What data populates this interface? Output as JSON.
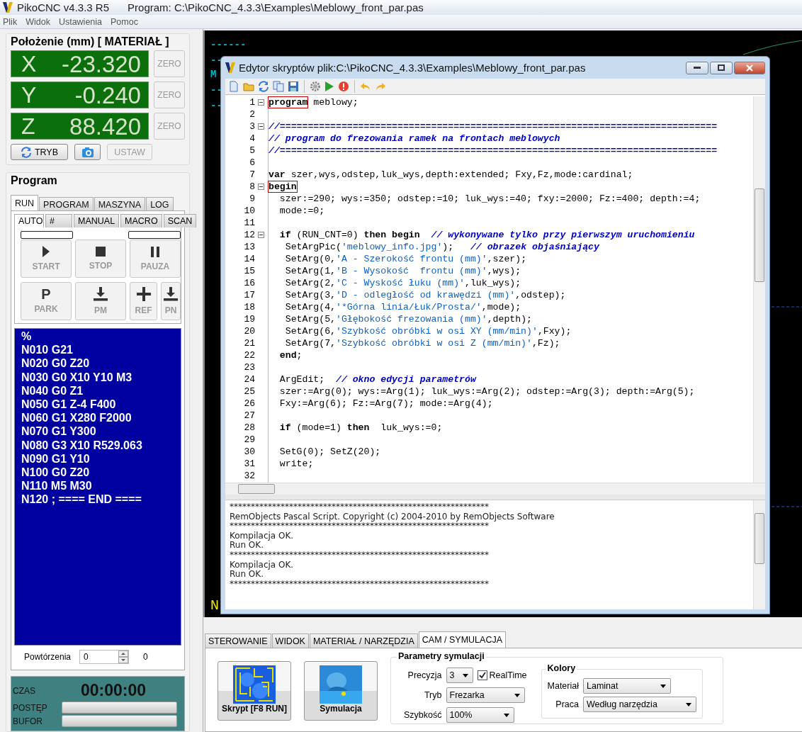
{
  "window": {
    "title": "PikoCNC v4.3.3 R5",
    "program": "Program: C:\\PikoCNC_4.3.3\\Examples\\Meblowy_front_par.pas"
  },
  "menu": [
    "Plik",
    "Widok",
    "Ustawienia",
    "Pomoc"
  ],
  "position": {
    "title": "Położenie (mm) [ MATERIAŁ ]",
    "axes": [
      {
        "axis": "X",
        "value": "-23.320",
        "button": "ZERO",
        "disabled": true
      },
      {
        "axis": "Y",
        "value": "-0.240",
        "button": "ZERO",
        "disabled": true
      },
      {
        "axis": "Z",
        "value": "88.420",
        "button": "ZERO",
        "disabled": true
      }
    ],
    "buttons": [
      {
        "kind": "mode",
        "label": "TRYB",
        "disabled": false
      },
      {
        "kind": "camera",
        "disabled": false
      },
      {
        "kind": "text",
        "label": "USTAW",
        "disabled": true
      }
    ]
  },
  "program": {
    "title": "Program",
    "tabs": [
      {
        "label": "RUN",
        "selected": true
      },
      {
        "label": "PROGRAM",
        "selected": false
      },
      {
        "label": "MASZYNA",
        "selected": false
      },
      {
        "label": "LOG",
        "selected": false
      }
    ],
    "subtabs": [
      {
        "label": "AUTO",
        "selected": true
      },
      {
        "label": "#",
        "selected": false
      },
      {
        "label": "MANUAL",
        "selected": false
      },
      {
        "label": "MACRO",
        "selected": false
      },
      {
        "label": "SCAN",
        "selected": false
      }
    ],
    "indicators": [
      {
        "level": 0
      },
      {
        "level": 0
      }
    ],
    "buttons": [
      {
        "kind": "play",
        "label": "START",
        "disabled": true
      },
      {
        "kind": "stop",
        "label": "STOP",
        "disabled": true
      },
      {
        "kind": "pause",
        "label": "PAUZA",
        "disabled": true
      },
      {
        "kind": "glyph",
        "glyph": "P",
        "label": "PARK",
        "disabled": true
      },
      {
        "kind": "down",
        "label": "PM",
        "disabled": true
      },
      {
        "kind": "plus",
        "label": "REF",
        "disabled": true
      },
      {
        "kind": "down",
        "label": "PN",
        "disabled": true
      }
    ],
    "gcode": [
      "%",
      "N010 G21",
      "N020 G0 Z20",
      "N030 G0 X10 Y10 M3",
      "N040 G0 Z1",
      "N050 G1 Z-4 F400",
      "N060 G1 X280 F2000",
      "N070 G1 Y300",
      "N080 G3 X10 R529.063",
      "N090 G1 Y10",
      "N100 G0 Z20",
      "N110 M5 M30",
      "N120 ; ==== END ===="
    ],
    "repeats": {
      "label": "Powtórzenia",
      "value": "0",
      "count": "0"
    },
    "status": {
      "time_label": "CZAS",
      "time": "00:00:00",
      "bars": [
        {
          "label": "POSTĘP",
          "level": 0
        },
        {
          "label": "BUFOR",
          "level": 0
        }
      ]
    }
  },
  "canvas": {
    "labels": [
      {
        "text": "------",
        "color": "#00b8c8"
      },
      {
        "text": "--",
        "color": "#00b8c8"
      },
      {
        "text": "M",
        "color": "#00b8c8"
      },
      {
        "text": "--",
        "color": "#00b8c8"
      },
      {
        "text": "--",
        "color": "#00b8c8"
      },
      {
        "text": "N",
        "color": "#e8e800"
      }
    ]
  },
  "editor": {
    "title": "Edytor skryptów plik:C:\\PikoCNC_4.3.3\\Examples\\Meblowy_front_par.pas",
    "lines": [
      {
        "number": "1",
        "fold": true,
        "segments": [
          {
            "kind": "keyword",
            "text": "program",
            "highlighted": true
          },
          {
            "kind": "plain",
            "text": " meblowy;"
          }
        ]
      },
      {
        "number": "2",
        "fold": false
      },
      {
        "number": "3",
        "fold": true,
        "segments": [
          {
            "kind": "comment",
            "text": "//=============================================================================="
          }
        ]
      },
      {
        "number": "4",
        "fold": false,
        "segments": [
          {
            "kind": "comment",
            "text": "// program do frezowania ramek na frontach meblowych"
          }
        ]
      },
      {
        "number": "5",
        "fold": false,
        "segments": [
          {
            "kind": "comment",
            "text": "//=============================================================================="
          }
        ]
      },
      {
        "number": "6",
        "fold": false
      },
      {
        "number": "7",
        "fold": false,
        "segments": [
          {
            "kind": "keyword",
            "text": "var"
          },
          {
            "kind": "plain",
            "text": " szer,wys,odstep,luk_wys,depth:extended; Fxy,Fz,mode:cardinal;"
          }
        ]
      },
      {
        "number": "8",
        "fold": true,
        "segments": [
          {
            "kind": "keyword",
            "text": "begin",
            "highlighted": true
          }
        ]
      },
      {
        "number": "9",
        "fold": false,
        "segments": [
          {
            "kind": "plain",
            "text": "  szer:=290; wys:=350; odstep:=10; luk_wys:=40; fxy:=2000; Fz:=400; depth:=4;"
          }
        ]
      },
      {
        "number": "10",
        "fold": false,
        "segments": [
          {
            "kind": "plain",
            "text": "  mode:=0;"
          }
        ]
      },
      {
        "number": "11",
        "fold": false
      },
      {
        "number": "12",
        "fold": true,
        "segments": [
          {
            "kind": "keyword",
            "text": "  if"
          },
          {
            "kind": "plain",
            "text": " (RUN_CNT=0) "
          },
          {
            "kind": "keyword",
            "text": "then begin"
          },
          {
            "kind": "comment",
            "text": "  // wykonywane tylko przy pierwszym uruchomieniu"
          }
        ]
      },
      {
        "number": "13",
        "fold": false,
        "segments": [
          {
            "kind": "plain",
            "text": "   SetArgPic("
          },
          {
            "kind": "string",
            "text": "'meblowy_info.jpg'"
          },
          {
            "kind": "plain",
            "text": ");   "
          },
          {
            "kind": "comment",
            "text": "// obrazek objaśniający"
          }
        ]
      },
      {
        "number": "14",
        "fold": false,
        "segments": [
          {
            "kind": "plain",
            "text": "   SetArg(0,"
          },
          {
            "kind": "string",
            "text": "'A - Szerokość frontu (mm)'"
          },
          {
            "kind": "plain",
            "text": ",szer);"
          }
        ]
      },
      {
        "number": "15",
        "fold": false,
        "segments": [
          {
            "kind": "plain",
            "text": "   SetArg(1,"
          },
          {
            "kind": "string",
            "text": "'B - Wysokość  frontu (mm)'"
          },
          {
            "kind": "plain",
            "text": ",wys);"
          }
        ]
      },
      {
        "number": "16",
        "fold": false,
        "segments": [
          {
            "kind": "plain",
            "text": "   SetArg(2,"
          },
          {
            "kind": "string",
            "text": "'C - Wyskość łuku (mm)'"
          },
          {
            "kind": "plain",
            "text": ",luk_wys);"
          }
        ]
      },
      {
        "number": "17",
        "fold": false,
        "segments": [
          {
            "kind": "plain",
            "text": "   SetArg(3,"
          },
          {
            "kind": "string",
            "text": "'D - odległość od krawędzi (mm)'"
          },
          {
            "kind": "plain",
            "text": ",odstep);"
          }
        ]
      },
      {
        "number": "18",
        "fold": false,
        "segments": [
          {
            "kind": "plain",
            "text": "   SetArg(4,"
          },
          {
            "kind": "string",
            "text": "'*Górna linia/Łuk/Prosta/'"
          },
          {
            "kind": "plain",
            "text": ",mode);"
          }
        ]
      },
      {
        "number": "19",
        "fold": false,
        "segments": [
          {
            "kind": "plain",
            "text": "   SetArg(5,"
          },
          {
            "kind": "string",
            "text": "'Głębokość frezowania (mm)'"
          },
          {
            "kind": "plain",
            "text": ",depth);"
          }
        ]
      },
      {
        "number": "20",
        "fold": false,
        "segments": [
          {
            "kind": "plain",
            "text": "   SetArg(6,"
          },
          {
            "kind": "string",
            "text": "'Szybkość obróbki w osi XY (mm/min)'"
          },
          {
            "kind": "plain",
            "text": ",Fxy);"
          }
        ]
      },
      {
        "number": "21",
        "fold": false,
        "segments": [
          {
            "kind": "plain",
            "text": "   SetArg(7,"
          },
          {
            "kind": "string",
            "text": "'Szybkość obróbki w osi Z (mm/min)'"
          },
          {
            "kind": "plain",
            "text": ",Fz);"
          }
        ]
      },
      {
        "number": "22",
        "fold": false,
        "segments": [
          {
            "kind": "keyword",
            "text": "  end"
          },
          {
            "kind": "plain",
            "text": ";"
          }
        ]
      },
      {
        "number": "23",
        "fold": false
      },
      {
        "number": "24",
        "fold": false,
        "segments": [
          {
            "kind": "plain",
            "text": "  ArgEdit;  "
          },
          {
            "kind": "comment",
            "text": "// okno edycji parametrów"
          }
        ]
      },
      {
        "number": "25",
        "fold": false,
        "segments": [
          {
            "kind": "plain",
            "text": "  szer:=Arg(0); wys:=Arg(1); luk_wys:=Arg(2); odstep:=Arg(3); depth:=Arg(5);"
          }
        ]
      },
      {
        "number": "26",
        "fold": false,
        "segments": [
          {
            "kind": "plain",
            "text": "  Fxy:=Arg(6); Fz:=Arg(7); mode:=Arg(4);"
          }
        ]
      },
      {
        "number": "27",
        "fold": false
      },
      {
        "number": "28",
        "fold": false,
        "segments": [
          {
            "kind": "keyword",
            "text": "  if"
          },
          {
            "kind": "plain",
            "text": " (mode=1) "
          },
          {
            "kind": "keyword",
            "text": "then"
          },
          {
            "kind": "plain",
            "text": "  luk_wys:=0;"
          }
        ]
      },
      {
        "number": "29",
        "fold": false
      },
      {
        "number": "30",
        "fold": false,
        "segments": [
          {
            "kind": "plain",
            "text": "  SetG(0); SetZ(20);"
          }
        ]
      },
      {
        "number": "31",
        "fold": false,
        "segments": [
          {
            "kind": "plain",
            "text": "  write;"
          }
        ]
      },
      {
        "number": "32",
        "fold": false
      }
    ],
    "log_blocks": [
      [
        "*************************************************************",
        "RemObjects Pascal Script. Copyright (c) 2004-2010 by RemObjects Software"
      ],
      [
        "*************************************************************",
        "Kompilacja OK.",
        "Run OK.",
        "*************************************************************",
        "Kompilacja OK.",
        "Run OK.",
        "*************************************************************"
      ]
    ]
  },
  "bottom": {
    "tabs": [
      {
        "label": "STEROWANIE",
        "selected": false
      },
      {
        "label": "WIDOK",
        "selected": false
      },
      {
        "label": "MATERIAŁ / NARZĘDZIA",
        "selected": false
      },
      {
        "label": "CAM / SYMULACJA",
        "selected": true
      }
    ],
    "actions": [
      {
        "kind": "maze",
        "label": "Skrypt [F8 RUN]"
      },
      {
        "kind": "picture",
        "label": "Symulacja"
      }
    ],
    "simulation": {
      "title": "Parametry symulacji",
      "precision": {
        "label": "Precyzja",
        "value": "3"
      },
      "realtime": {
        "label": "RealTime",
        "checked": true
      },
      "mode": {
        "label": "Tryb",
        "value": "Frezarka"
      },
      "speed": {
        "label": "Szybkość",
        "value": "100%"
      }
    },
    "colors": {
      "title": "Kolory",
      "fields": [
        {
          "label": "Materiał",
          "value": "Laminat"
        },
        {
          "label": "Praca",
          "value": "Według narzędzia"
        }
      ]
    }
  }
}
